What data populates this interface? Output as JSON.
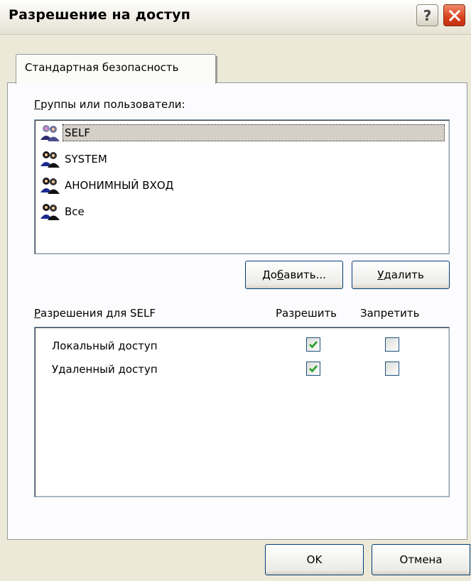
{
  "window": {
    "title": "Разрешение на доступ"
  },
  "tabs": [
    {
      "label": "Стандартная безопасность"
    }
  ],
  "groups": {
    "label_u": "Г",
    "label_rest": "руппы или пользователи:",
    "items": [
      {
        "label": "SELF"
      },
      {
        "label": "SYSTEM"
      },
      {
        "label": "АНОНИМНЫЙ ВХОД"
      },
      {
        "label": "Все"
      }
    ]
  },
  "buttons": {
    "add_pre": "До",
    "add_u": "б",
    "add_post": "авить...",
    "remove_u": "У",
    "remove_post": "далить",
    "ok": "OK",
    "cancel": "Отмена"
  },
  "permissions": {
    "label_u": "Р",
    "label_rest": "азрешения для SELF",
    "col_allow": "Разрешить",
    "col_deny": "Запретить",
    "rows": [
      {
        "label": "Локальный доступ",
        "allow": true,
        "deny": false
      },
      {
        "label": "Удаленный доступ",
        "allow": true,
        "deny": false
      }
    ]
  },
  "colors": {
    "check": "#21a121",
    "selection": "#d4d0c8",
    "close": "#d7411b"
  },
  "icons": {
    "help": "?",
    "close": "close-icon",
    "group": "users-group-icon"
  }
}
